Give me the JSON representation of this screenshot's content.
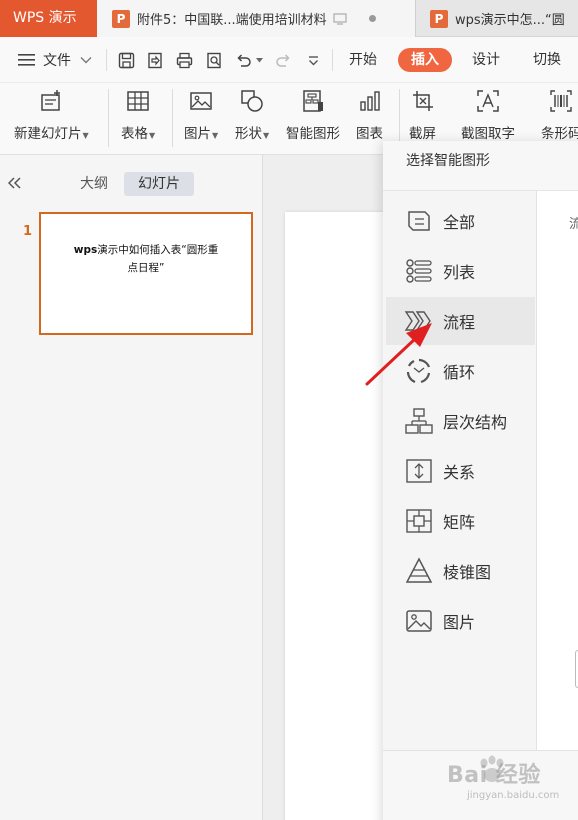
{
  "tabs": {
    "app": "WPS 演示",
    "doc1": "附件5：中国联...端使用培训材料",
    "doc2": "wps演示中怎...“圆"
  },
  "menubar": {
    "file": "文件",
    "tabs": [
      "开始",
      "插入",
      "设计",
      "切换"
    ],
    "active_tab": "插入"
  },
  "ribbon": {
    "buttons": [
      {
        "label": "新建幻灯片",
        "icon": "new-slide-icon",
        "dropdown": true
      },
      {
        "label": "表格",
        "icon": "table-icon",
        "dropdown": true
      },
      {
        "label": "图片",
        "icon": "picture-icon",
        "dropdown": true
      },
      {
        "label": "形状",
        "icon": "shapes-icon",
        "dropdown": true
      },
      {
        "label": "智能图形",
        "icon": "smart-graphic-icon",
        "dropdown": false
      },
      {
        "label": "图表",
        "icon": "chart-icon",
        "dropdown": false
      },
      {
        "label": "截屏",
        "icon": "screenshot-icon",
        "dropdown": false
      },
      {
        "label": "截图取字",
        "icon": "ocr-icon",
        "dropdown": false
      },
      {
        "label": "条形码",
        "icon": "barcode-icon",
        "dropdown": false
      }
    ]
  },
  "left_panel": {
    "tabs": [
      "大纲",
      "幻灯片"
    ],
    "active_tab": "幻灯片",
    "slide_number": "1",
    "slide_title_bold": "wps",
    "slide_title_rest": "演示中如何插入表“圆形重点日程”"
  },
  "dialog": {
    "title": "选择智能图形",
    "content_header": "流",
    "selected_category": "流程",
    "categories": [
      {
        "label": "全部",
        "icon": "all-icon"
      },
      {
        "label": "列表",
        "icon": "list-icon"
      },
      {
        "label": "流程",
        "icon": "process-icon"
      },
      {
        "label": "循环",
        "icon": "cycle-icon"
      },
      {
        "label": "层次结构",
        "icon": "hierarchy-icon"
      },
      {
        "label": "关系",
        "icon": "relationship-icon"
      },
      {
        "label": "矩阵",
        "icon": "matrix-icon"
      },
      {
        "label": "棱锥图",
        "icon": "pyramid-icon"
      },
      {
        "label": "图片",
        "icon": "picture-icon"
      }
    ]
  },
  "watermark": {
    "main": "Bai  经验",
    "sub": "jingyan.baidu.com"
  },
  "colors": {
    "accent": "#e3582f",
    "insert_tab": "#ef6640",
    "thumb_border": "#d2691e",
    "annotation_arrow": "#e02020"
  }
}
